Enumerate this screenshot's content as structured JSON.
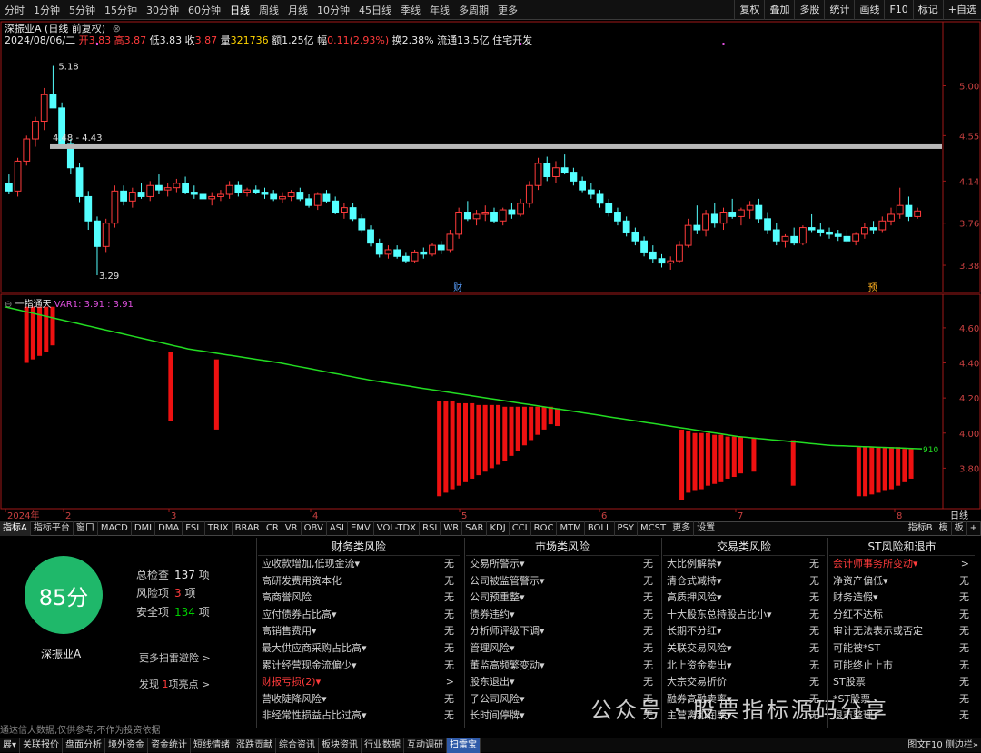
{
  "topbar": {
    "periods": [
      "分时",
      "1分钟",
      "5分钟",
      "15分钟",
      "30分钟",
      "60分钟",
      "日线",
      "周线",
      "月线",
      "10分钟",
      "45日线",
      "季线",
      "年线",
      "多周期",
      "更多"
    ],
    "active": "日线",
    "right_buttons": [
      "复权",
      "叠加",
      "多股",
      "统计",
      "画线",
      "F10",
      "标记",
      "+自选"
    ]
  },
  "stock": {
    "title": "深振业A (日线 前复权)",
    "date": "2024/08/06/二",
    "open_label": "开",
    "open": "3.83",
    "high_label": "高",
    "high": "3.87",
    "low_label": "低",
    "low": "3.83",
    "close_label": "收",
    "close": "3.87",
    "volume_label": "量",
    "volume": "321736",
    "amount_label": "额",
    "amount": "1.25亿",
    "change_label": "幅",
    "change": "0.11(2.93%)",
    "turnover_label": "换",
    "turnover": "2.38%",
    "float_label": "流通",
    "float": "13.5亿",
    "sector": "住宅开发"
  },
  "main_chart": {
    "y_labels": [
      "5.00",
      "4.55",
      "4.14",
      "3.76",
      "3.38"
    ],
    "ylim": [
      3.2,
      5.25
    ],
    "max_label": "5.18",
    "min_label": "3.29",
    "range_label": "4.48 - 4.43",
    "markers": [
      "财",
      "预"
    ],
    "candles": [
      [
        4.12,
        4.2,
        4.02,
        4.05
      ],
      [
        4.05,
        4.35,
        4.0,
        4.32
      ],
      [
        4.32,
        4.55,
        4.28,
        4.52
      ],
      [
        4.52,
        4.72,
        4.45,
        4.68
      ],
      [
        4.68,
        4.98,
        4.6,
        4.92
      ],
      [
        4.92,
        5.18,
        4.85,
        4.8
      ],
      [
        4.8,
        4.85,
        4.44,
        4.48
      ],
      [
        4.48,
        4.52,
        4.2,
        4.26
      ],
      [
        4.26,
        4.3,
        3.95,
        4.0
      ],
      [
        4.0,
        4.05,
        3.7,
        3.78
      ],
      [
        3.78,
        3.82,
        3.29,
        3.55
      ],
      [
        3.55,
        3.8,
        3.5,
        3.76
      ],
      [
        3.76,
        4.1,
        3.72,
        4.05
      ],
      [
        4.05,
        4.1,
        3.92,
        3.96
      ],
      [
        3.96,
        4.08,
        3.9,
        4.04
      ],
      [
        4.04,
        4.12,
        3.98,
        4.0
      ],
      [
        4.0,
        4.14,
        3.96,
        4.1
      ],
      [
        4.1,
        4.2,
        4.02,
        4.06
      ],
      [
        4.06,
        4.12,
        4.0,
        4.08
      ],
      [
        4.08,
        4.16,
        4.04,
        4.12
      ],
      [
        4.12,
        4.18,
        4.02,
        4.04
      ],
      [
        4.04,
        4.1,
        3.98,
        4.02
      ],
      [
        4.02,
        4.06,
        3.94,
        3.98
      ],
      [
        3.98,
        4.04,
        3.92,
        4.0
      ],
      [
        4.0,
        4.06,
        3.96,
        4.02
      ],
      [
        4.02,
        4.14,
        3.98,
        4.1
      ],
      [
        4.1,
        4.14,
        4.0,
        4.04
      ],
      [
        4.04,
        4.08,
        4.0,
        4.06
      ],
      [
        4.06,
        4.1,
        4.02,
        4.04
      ],
      [
        4.04,
        4.08,
        3.98,
        4.02
      ],
      [
        4.02,
        4.06,
        3.96,
        3.98
      ],
      [
        3.98,
        4.04,
        3.94,
        4.0
      ],
      [
        4.0,
        4.06,
        3.96,
        4.04
      ],
      [
        4.04,
        4.08,
        3.96,
        3.98
      ],
      [
        3.98,
        4.02,
        3.9,
        3.92
      ],
      [
        3.92,
        4.04,
        3.88,
        4.02
      ],
      [
        4.02,
        4.06,
        3.94,
        3.96
      ],
      [
        3.96,
        4.0,
        3.84,
        3.86
      ],
      [
        3.86,
        3.94,
        3.8,
        3.9
      ],
      [
        3.9,
        3.94,
        3.78,
        3.8
      ],
      [
        3.8,
        3.84,
        3.68,
        3.7
      ],
      [
        3.7,
        3.74,
        3.55,
        3.58
      ],
      [
        3.58,
        3.62,
        3.45,
        3.48
      ],
      [
        3.48,
        3.56,
        3.44,
        3.52
      ],
      [
        3.52,
        3.56,
        3.44,
        3.46
      ],
      [
        3.46,
        3.5,
        3.4,
        3.42
      ],
      [
        3.42,
        3.52,
        3.4,
        3.5
      ],
      [
        3.5,
        3.54,
        3.44,
        3.48
      ],
      [
        3.48,
        3.58,
        3.46,
        3.56
      ],
      [
        3.56,
        3.6,
        3.48,
        3.52
      ],
      [
        3.52,
        3.7,
        3.5,
        3.66
      ],
      [
        3.66,
        3.9,
        3.62,
        3.86
      ],
      [
        3.86,
        3.96,
        3.78,
        3.8
      ],
      [
        3.8,
        3.88,
        3.74,
        3.84
      ],
      [
        3.84,
        3.92,
        3.78,
        3.86
      ],
      [
        3.86,
        3.9,
        3.76,
        3.78
      ],
      [
        3.78,
        3.9,
        3.74,
        3.88
      ],
      [
        3.88,
        3.94,
        3.8,
        3.84
      ],
      [
        3.84,
        3.98,
        3.82,
        3.94
      ],
      [
        3.94,
        4.14,
        3.9,
        4.1
      ],
      [
        4.1,
        4.35,
        4.06,
        4.3
      ],
      [
        4.3,
        4.36,
        4.14,
        4.18
      ],
      [
        4.18,
        4.32,
        4.12,
        4.26
      ],
      [
        4.26,
        4.38,
        4.2,
        4.22
      ],
      [
        4.22,
        4.26,
        4.1,
        4.14
      ],
      [
        4.14,
        4.18,
        4.04,
        4.06
      ],
      [
        4.06,
        4.12,
        3.98,
        4.02
      ],
      [
        4.02,
        4.06,
        3.9,
        3.94
      ],
      [
        3.94,
        3.98,
        3.82,
        3.86
      ],
      [
        3.86,
        3.9,
        3.74,
        3.78
      ],
      [
        3.78,
        3.82,
        3.64,
        3.68
      ],
      [
        3.68,
        3.72,
        3.56,
        3.6
      ],
      [
        3.6,
        3.64,
        3.46,
        3.5
      ],
      [
        3.5,
        3.56,
        3.4,
        3.44
      ],
      [
        3.44,
        3.48,
        3.36,
        3.4
      ],
      [
        3.4,
        3.46,
        3.34,
        3.42
      ],
      [
        3.42,
        3.6,
        3.4,
        3.56
      ],
      [
        3.56,
        3.8,
        3.54,
        3.74
      ],
      [
        3.74,
        3.92,
        3.66,
        3.7
      ],
      [
        3.7,
        3.88,
        3.64,
        3.84
      ],
      [
        3.84,
        3.94,
        3.72,
        3.76
      ],
      [
        3.76,
        3.9,
        3.7,
        3.86
      ],
      [
        3.86,
        3.98,
        3.8,
        3.82
      ],
      [
        3.82,
        3.9,
        3.74,
        3.88
      ],
      [
        3.88,
        3.96,
        3.8,
        3.92
      ],
      [
        3.92,
        3.98,
        3.76,
        3.8
      ],
      [
        3.8,
        3.86,
        3.66,
        3.7
      ],
      [
        3.7,
        3.76,
        3.56,
        3.6
      ],
      [
        3.6,
        3.66,
        3.54,
        3.64
      ],
      [
        3.64,
        3.72,
        3.56,
        3.58
      ],
      [
        3.58,
        3.74,
        3.56,
        3.72
      ],
      [
        3.72,
        3.84,
        3.68,
        3.7
      ],
      [
        3.7,
        3.76,
        3.64,
        3.68
      ],
      [
        3.68,
        3.72,
        3.62,
        3.66
      ],
      [
        3.66,
        3.7,
        3.6,
        3.64
      ],
      [
        3.64,
        3.7,
        3.58,
        3.6
      ],
      [
        3.6,
        3.68,
        3.56,
        3.66
      ],
      [
        3.66,
        3.76,
        3.62,
        3.72
      ],
      [
        3.72,
        3.78,
        3.66,
        3.7
      ],
      [
        3.7,
        3.82,
        3.68,
        3.78
      ],
      [
        3.78,
        3.9,
        3.74,
        3.84
      ],
      [
        3.84,
        4.08,
        3.8,
        3.92
      ],
      [
        3.92,
        4.0,
        3.78,
        3.82
      ],
      [
        3.82,
        3.9,
        3.8,
        3.87
      ]
    ],
    "up_color": "#ff3b3b",
    "down_color": "#54ffff"
  },
  "indicator": {
    "name": "一指通天",
    "var_label": "VAR1: 3.91 : 3.91",
    "y_labels": [
      "4.60",
      "4.40",
      "4.20",
      "4.00",
      "3.80"
    ],
    "ylim": [
      3.6,
      4.76
    ],
    "end_label": "910",
    "line_color": "#22dd22",
    "bar_color": "#ee1111",
    "line": [
      4.72,
      4.6,
      4.48,
      4.4,
      4.3,
      4.22,
      4.14,
      4.06,
      3.98,
      3.93,
      3.91
    ],
    "bars": [
      [
        3,
        4.72,
        4.4
      ],
      [
        4,
        4.72,
        4.42
      ],
      [
        5,
        4.72,
        4.44
      ],
      [
        6,
        4.72,
        4.46
      ],
      [
        7,
        4.72,
        4.5
      ],
      [
        25,
        4.46,
        4.07
      ],
      [
        32,
        4.42,
        4.02
      ],
      [
        66,
        4.18,
        3.64
      ],
      [
        67,
        4.18,
        3.66
      ],
      [
        68,
        4.18,
        3.68
      ],
      [
        69,
        4.17,
        3.7
      ],
      [
        70,
        4.17,
        3.72
      ],
      [
        71,
        4.17,
        3.74
      ],
      [
        72,
        4.16,
        3.76
      ],
      [
        73,
        4.16,
        3.78
      ],
      [
        74,
        4.16,
        3.8
      ],
      [
        75,
        4.16,
        3.82
      ],
      [
        76,
        4.15,
        3.84
      ],
      [
        77,
        4.15,
        3.87
      ],
      [
        78,
        4.15,
        3.9
      ],
      [
        79,
        4.15,
        3.93
      ],
      [
        80,
        4.15,
        3.96
      ],
      [
        81,
        4.15,
        3.99
      ],
      [
        82,
        4.15,
        4.02
      ],
      [
        83,
        4.15,
        4.05
      ],
      [
        84,
        4.14,
        4.04
      ],
      [
        103,
        4.02,
        3.62
      ],
      [
        104,
        4.01,
        3.66
      ],
      [
        105,
        4.0,
        3.67
      ],
      [
        106,
        4.0,
        3.68
      ],
      [
        107,
        4.0,
        3.7
      ],
      [
        108,
        3.99,
        3.71
      ],
      [
        109,
        3.99,
        3.72
      ],
      [
        110,
        3.98,
        3.74
      ],
      [
        111,
        3.98,
        3.75
      ],
      [
        112,
        3.98,
        3.77
      ],
      [
        114,
        3.97,
        3.78
      ],
      [
        120,
        3.96,
        3.7
      ],
      [
        130,
        3.92,
        3.64
      ],
      [
        131,
        3.92,
        3.64
      ],
      [
        132,
        3.92,
        3.65
      ],
      [
        133,
        3.92,
        3.66
      ],
      [
        134,
        3.92,
        3.67
      ],
      [
        135,
        3.92,
        3.68
      ],
      [
        136,
        3.92,
        3.7
      ],
      [
        137,
        3.91,
        3.72
      ],
      [
        138,
        3.91,
        3.74
      ]
    ]
  },
  "date_axis": [
    "2024年",
    "2",
    "3",
    "4",
    "5",
    "6",
    "7",
    "8"
  ],
  "date_axis_right": "日线",
  "tabs": {
    "items": [
      "指标A",
      "指标平台",
      "窗口",
      "MACD",
      "DMI",
      "DMA",
      "FSL",
      "TRIX",
      "BRAR",
      "CR",
      "VR",
      "OBV",
      "ASI",
      "EMV",
      "VOL-TDX",
      "RSI",
      "WR",
      "SAR",
      "KDJ",
      "CCI",
      "ROC",
      "MTM",
      "BOLL",
      "PSY",
      "MCST",
      "更多",
      "设置"
    ],
    "right": [
      "指标B",
      "模",
      "板",
      "+"
    ]
  },
  "scan": {
    "score": "85分",
    "name": "深振业A",
    "total_label": "总检查",
    "total": "137",
    "unit": "项",
    "risk_label": "风险项",
    "risk": "3",
    "safe_label": "安全项",
    "safe": "134",
    "more_label": "更多扫雷避险 >",
    "found_prefix": "发现",
    "found_count": "1",
    "found_suffix": "项亮点 >",
    "disclaimer": "通达信大数据,仅供参考,不作为投资依据",
    "columns": [
      {
        "title": "财务类风险",
        "rows": [
          {
            "label": "应收款增加,低现金流▾",
            "status": "无"
          },
          {
            "label": "高研发费用资本化",
            "status": "无"
          },
          {
            "label": "高商誉风险",
            "status": "无"
          },
          {
            "label": "应付债券占比高▾",
            "status": "无"
          },
          {
            "label": "高销售费用▾",
            "status": "无"
          },
          {
            "label": "最大供应商采购占比高▾",
            "status": "无"
          },
          {
            "label": "累计经营现金流偏少▾",
            "status": "无"
          },
          {
            "label": "财报亏损(2)▾",
            "status": ">",
            "alert": true
          },
          {
            "label": "营收陡降风险▾",
            "status": "无"
          },
          {
            "label": "非经常性损益占比过高▾",
            "status": "无"
          }
        ]
      },
      {
        "title": "市场类风险",
        "rows": [
          {
            "label": "交易所警示▾",
            "status": "无"
          },
          {
            "label": "公司被监管警示▾",
            "status": "无"
          },
          {
            "label": "公司预重整▾",
            "status": "无"
          },
          {
            "label": "债券违约▾",
            "status": "无"
          },
          {
            "label": "分析师评级下调▾",
            "status": "无"
          },
          {
            "label": "管理风险▾",
            "status": "无"
          },
          {
            "label": "董监高频繁变动▾",
            "status": "无"
          },
          {
            "label": "股东退出▾",
            "status": "无"
          },
          {
            "label": "子公司风险▾",
            "status": "无"
          },
          {
            "label": "长时间停牌▾",
            "status": "无"
          }
        ]
      },
      {
        "title": "交易类风险",
        "rows": [
          {
            "label": "大比例解禁▾",
            "status": "无"
          },
          {
            "label": "清仓式减持▾",
            "status": "无"
          },
          {
            "label": "高质押风险▾",
            "status": "无"
          },
          {
            "label": "十大股东总持股占比小▾",
            "status": "无"
          },
          {
            "label": "长期不分红▾",
            "status": "无"
          },
          {
            "label": "关联交易风险▾",
            "status": "无"
          },
          {
            "label": "北上资金卖出▾",
            "status": "无"
          },
          {
            "label": "大宗交易折价",
            "status": "无"
          },
          {
            "label": "融券高融卖率▾",
            "status": "无"
          },
          {
            "label": "主营离和润率▾",
            "status": "无"
          }
        ]
      },
      {
        "title": "ST风险和退市",
        "rows": [
          {
            "label": "会计师事务所变动▾",
            "status": ">",
            "alert": true
          },
          {
            "label": "净资产偏低▾",
            "status": "无"
          },
          {
            "label": "财务造假▾",
            "status": "无"
          },
          {
            "label": "分红不达标",
            "status": "无"
          },
          {
            "label": "审计无法表示或否定",
            "status": "无"
          },
          {
            "label": "可能被*ST",
            "status": "无"
          },
          {
            "label": "可能终止上市",
            "status": "无"
          },
          {
            "label": "ST股票",
            "status": "无"
          },
          {
            "label": "*ST股票",
            "status": "无"
          },
          {
            "label": "退市整理",
            "status": "无"
          }
        ]
      }
    ]
  },
  "bottombar": {
    "items": [
      "展▾",
      "关联报价",
      "盘面分析",
      "境外资金",
      "资金统计",
      "短线情绪",
      "涨跌贡献",
      "综合资讯",
      "板块资讯",
      "行业数据",
      "互动调研",
      "扫雷宝"
    ],
    "active": "扫雷宝",
    "right": "图文F10 侧边栏»"
  },
  "watermark": "公众号 · 股票指标源码分享"
}
